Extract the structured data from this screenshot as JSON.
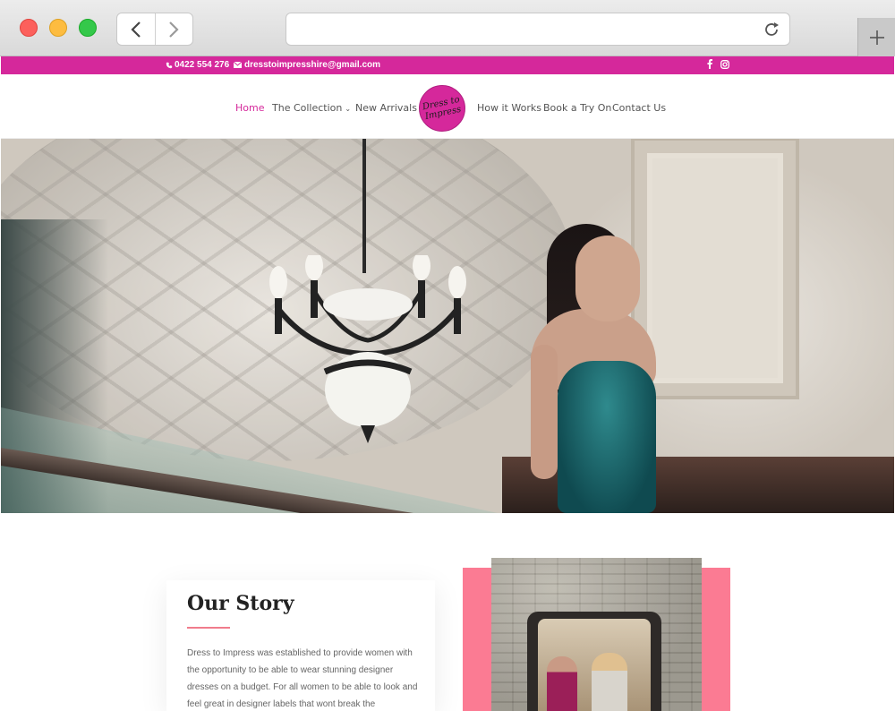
{
  "browser": {
    "address_value": "",
    "icons": [
      "back-icon",
      "forward-icon",
      "reload-icon",
      "new-tab-icon"
    ]
  },
  "topbar": {
    "phone": "0422 554 276",
    "email": "dresstoimpresshire@gmail.com",
    "social": [
      "facebook-icon",
      "instagram-icon"
    ],
    "background": "#d5289b"
  },
  "nav": {
    "items": [
      {
        "label": "Home",
        "active": true
      },
      {
        "label": "The Collection",
        "dropdown": true
      },
      {
        "label": "New Arrivals"
      },
      {
        "label": "How it Works"
      },
      {
        "label": "Book a Try On"
      },
      {
        "label": "Contact Us"
      }
    ],
    "logo_text": "Dress to Impress",
    "accent": "#d5289b"
  },
  "story": {
    "title": "Our Story",
    "paragraph": "Dress to Impress was established to provide women with the opportunity to be able to wear stunning designer dresses on a budget. For all women to be able to look and feel great in designer labels that wont break the",
    "rule_color": "#f07c8c",
    "block_color": "#fb7b93"
  }
}
